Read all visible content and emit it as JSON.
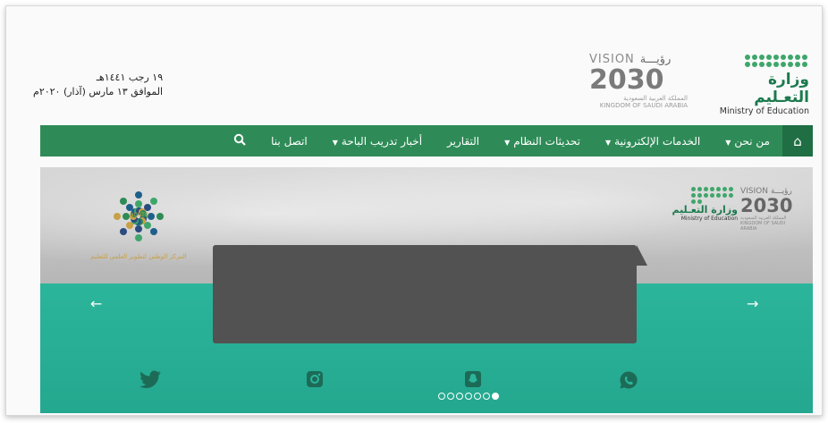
{
  "header": {
    "date_hijri": "١٩ رجب ١٤٤١هـ",
    "date_gregorian": "الموافق ١٣ مارس (آذار) ٢٠٢٠م",
    "vision_word": "VISION",
    "vision_ar": "رؤيـــة",
    "vision_year": "2030",
    "vision_ksa_ar": "المملكة العربية السعودية",
    "vision_ksa_en": "KINGDOM OF SAUDI ARABIA",
    "ministry_ar": "وزارة التعـليم",
    "ministry_en": "Ministry of Education"
  },
  "nav": {
    "home_icon": "home-icon",
    "items": [
      {
        "label": "من نحن",
        "dropdown": true
      },
      {
        "label": "الخدمات الإلكترونية",
        "dropdown": true
      },
      {
        "label": "تحديثات النظام",
        "dropdown": true
      },
      {
        "label": "التقارير",
        "dropdown": false
      },
      {
        "label": "أخبار تدريب الباحة",
        "dropdown": true
      },
      {
        "label": "اتصل بنا",
        "dropdown": false
      }
    ],
    "search_icon": "search-icon",
    "color": "#2e8b57"
  },
  "banner": {
    "ministry_ar": "وزارة التعـليم",
    "ministry_en": "Ministry of Education",
    "vision_word": "VISION",
    "vision_ar": "رؤيـــة",
    "vision_year": "2030",
    "vision_ksa_ar": "المملكة العربية السعودية",
    "vision_ksa_en": "KINGDOM OF SAUDI ARABIA",
    "ncgto_label": "المركز الوطني لتطوير العلمي للتعليم",
    "ncgto_center": "NCGTO",
    "social_icons": [
      "twitter-icon",
      "instagram-icon",
      "snapchat-icon",
      "whatsapp-icon"
    ],
    "slide_count": 7,
    "active_slide": 6,
    "accent": "#2bb59b"
  }
}
